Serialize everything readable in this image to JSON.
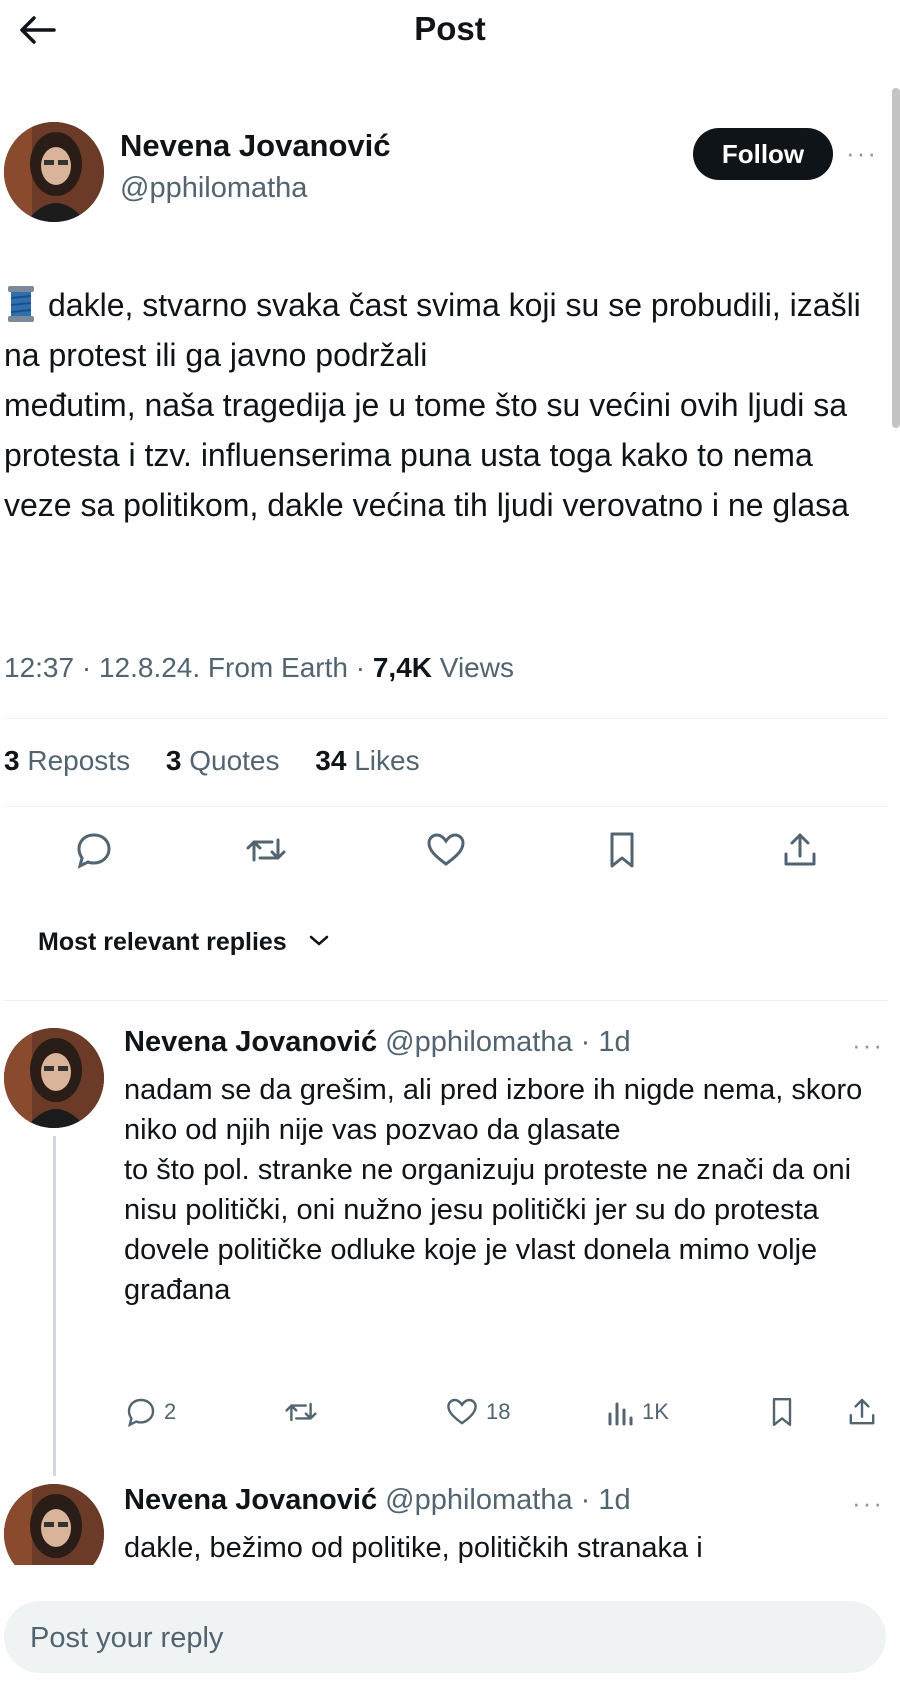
{
  "header": {
    "title": "Post"
  },
  "post": {
    "author_name": "Nevena Jovanović",
    "author_handle": "@pphilomatha",
    "follow_label": "Follow",
    "more_label": "···",
    "body_lines": [
      "dakle, stvarno svaka čast svima koji su se probudili, izašli na protest ili ga javno podržali",
      "međutim, naša tragedija je u tome što su većini ovih ljudi sa protesta i tzv. influenserima puna usta toga kako to nema veze sa politikom, dakle većina tih ljudi verovatno i ne glasa"
    ],
    "thread_icon": "thread-spool-icon",
    "meta_time": "12:37 · 12.8.24. From Earth · ",
    "views_count": "7,4K",
    "views_label": " Views",
    "reposts_count": "3",
    "reposts_label": " Reposts",
    "quotes_count": "3",
    "quotes_label": " Quotes",
    "likes_count": "34",
    "likes_label": " Likes"
  },
  "sort": {
    "label": "Most relevant replies"
  },
  "replies": [
    {
      "author_name": "Nevena Jovanović",
      "author_handle": "@pphilomatha",
      "time": "· 1d",
      "more_label": "···",
      "text_lines": [
        "nadam se da grešim, ali pred izbore ih nigde nema, skoro niko od njih nije vas pozvao da glasate",
        "to što pol. stranke ne organizuju proteste ne znači da oni nisu politički, oni nužno jesu politički jer su do protesta dovele političke odluke koje je vlast donela mimo volje građana"
      ],
      "reply_count": "2",
      "repost_count": "",
      "like_count": "18",
      "view_count": "1K"
    },
    {
      "author_name": "Nevena Jovanović",
      "author_handle": "@pphilomatha",
      "time": "· 1d",
      "more_label": "···",
      "text_lines": [
        "dakle, bežimo od politike, političkih stranaka i"
      ]
    }
  ],
  "composer": {
    "placeholder": "Post your reply"
  },
  "colors": {
    "text": "#0f1419",
    "muted": "#536471",
    "follow_bg": "#0f1419",
    "compose_bg": "#eff3f4"
  }
}
